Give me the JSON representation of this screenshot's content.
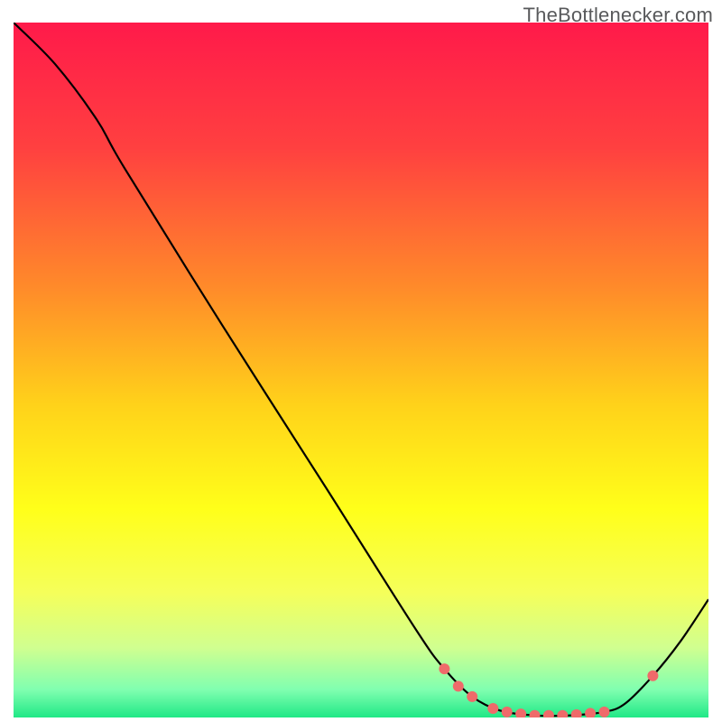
{
  "watermark": "TheBottlenecker.com",
  "chart_data": {
    "type": "line",
    "title": "",
    "xlabel": "",
    "ylabel": "",
    "xlim": [
      0,
      100
    ],
    "ylim": [
      0,
      100
    ],
    "background_gradient": {
      "stops": [
        {
          "offset": 0.0,
          "color": "#ff1a4a"
        },
        {
          "offset": 0.18,
          "color": "#ff4040"
        },
        {
          "offset": 0.38,
          "color": "#ff8a2a"
        },
        {
          "offset": 0.55,
          "color": "#ffd21a"
        },
        {
          "offset": 0.7,
          "color": "#ffff1a"
        },
        {
          "offset": 0.82,
          "color": "#f5ff5a"
        },
        {
          "offset": 0.9,
          "color": "#d0ff90"
        },
        {
          "offset": 0.96,
          "color": "#80ffb0"
        },
        {
          "offset": 1.0,
          "color": "#20e886"
        }
      ]
    },
    "series": [
      {
        "name": "curve",
        "color": "#000000",
        "points": [
          {
            "x": 0,
            "y": 100
          },
          {
            "x": 6,
            "y": 94
          },
          {
            "x": 12,
            "y": 86
          },
          {
            "x": 16,
            "y": 79
          },
          {
            "x": 30,
            "y": 56.5
          },
          {
            "x": 45,
            "y": 33
          },
          {
            "x": 58,
            "y": 12.5
          },
          {
            "x": 62,
            "y": 7
          },
          {
            "x": 66,
            "y": 3
          },
          {
            "x": 70,
            "y": 1
          },
          {
            "x": 75,
            "y": 0.3
          },
          {
            "x": 80,
            "y": 0.3
          },
          {
            "x": 85,
            "y": 0.8
          },
          {
            "x": 88,
            "y": 2
          },
          {
            "x": 92,
            "y": 6
          },
          {
            "x": 96,
            "y": 11
          },
          {
            "x": 100,
            "y": 17
          }
        ]
      }
    ],
    "markers": {
      "color": "#ef6a6a",
      "radius": 6,
      "points": [
        {
          "x": 62,
          "y": 7
        },
        {
          "x": 64,
          "y": 4.5
        },
        {
          "x": 66,
          "y": 3
        },
        {
          "x": 69,
          "y": 1.3
        },
        {
          "x": 71,
          "y": 0.8
        },
        {
          "x": 73,
          "y": 0.5
        },
        {
          "x": 75,
          "y": 0.3
        },
        {
          "x": 77,
          "y": 0.3
        },
        {
          "x": 79,
          "y": 0.3
        },
        {
          "x": 81,
          "y": 0.4
        },
        {
          "x": 83,
          "y": 0.6
        },
        {
          "x": 85,
          "y": 0.8
        },
        {
          "x": 92,
          "y": 6
        }
      ]
    }
  }
}
